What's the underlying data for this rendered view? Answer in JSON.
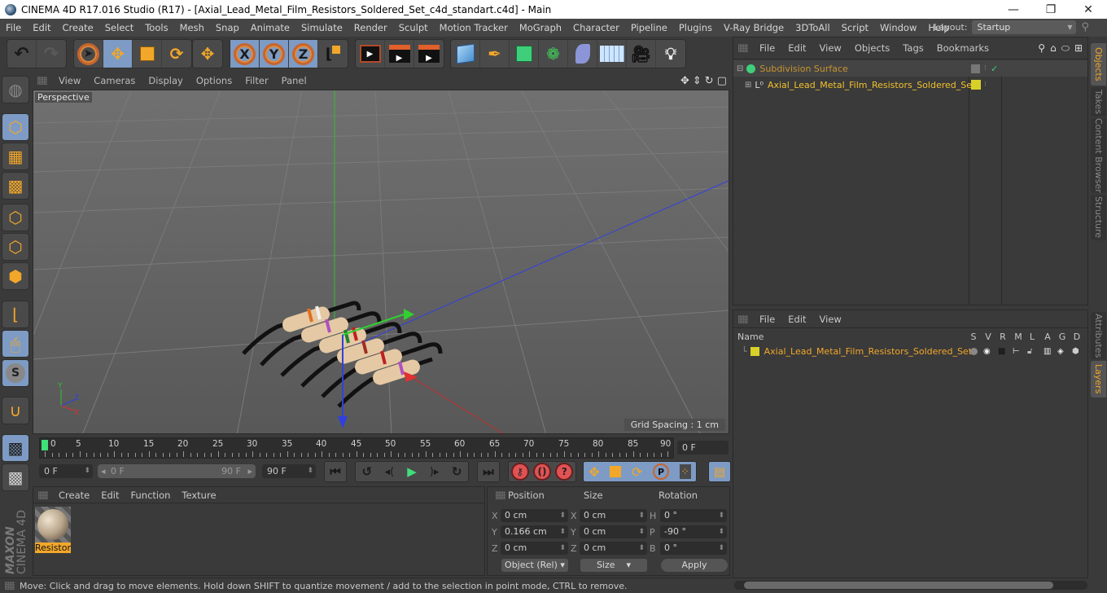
{
  "window": {
    "title": "CINEMA 4D R17.016 Studio (R17) - [Axial_Lead_Metal_Film_Resistors_Soldered_Set_c4d_standart.c4d] - Main",
    "minimize": "—",
    "maximize": "❐",
    "close": "✕"
  },
  "menubar": {
    "items": [
      "File",
      "Edit",
      "Create",
      "Select",
      "Tools",
      "Mesh",
      "Snap",
      "Animate",
      "Simulate",
      "Render",
      "Sculpt",
      "Motion Tracker",
      "MoGraph",
      "Character",
      "Pipeline",
      "Plugins",
      "V-Ray Bridge",
      "3DToAll",
      "Script",
      "Window",
      "Help"
    ],
    "layout_label": "Layout:",
    "layout_value": "Startup"
  },
  "toolbar": {
    "undo": "↶",
    "redo": "↷",
    "axis_x": "X",
    "axis_y": "Y",
    "axis_z": "Z"
  },
  "viewport": {
    "menu": [
      "View",
      "Cameras",
      "Display",
      "Options",
      "Filter",
      "Panel"
    ],
    "camera_label": "Perspective",
    "grid_spacing": "Grid Spacing : 1 cm",
    "axis_labels": {
      "x": "X",
      "y": "Y",
      "z": "Z"
    }
  },
  "timeline": {
    "ticks": [
      "0",
      "5",
      "10",
      "15",
      "20",
      "25",
      "30",
      "35",
      "40",
      "45",
      "50",
      "55",
      "60",
      "65",
      "70",
      "75",
      "80",
      "85",
      "90"
    ],
    "current_frame": "0 F",
    "start_field": "0 F",
    "range_start": "0 F",
    "range_end": "90 F",
    "end_field": "90 F"
  },
  "materials": {
    "menu": [
      "Create",
      "Edit",
      "Function",
      "Texture"
    ],
    "items": [
      {
        "name": "Resistor"
      }
    ]
  },
  "brand": {
    "line1": "MAXON",
    "line2": "CINEMA 4D"
  },
  "coordinates": {
    "headers": {
      "position": "Position",
      "size": "Size",
      "rotation": "Rotation"
    },
    "position": [
      {
        "axis": "X",
        "value": "0 cm"
      },
      {
        "axis": "Y",
        "value": "0.166 cm"
      },
      {
        "axis": "Z",
        "value": "0 cm"
      }
    ],
    "size": [
      {
        "axis": "X",
        "value": "0 cm"
      },
      {
        "axis": "Y",
        "value": "0 cm"
      },
      {
        "axis": "Z",
        "value": "0 cm"
      }
    ],
    "rotation": [
      {
        "axis": "H",
        "value": "0 °"
      },
      {
        "axis": "P",
        "value": "-90 °"
      },
      {
        "axis": "B",
        "value": "0 °"
      }
    ],
    "mode_dropdown": "Object (Rel)",
    "size_dropdown": "Size",
    "apply_label": "Apply"
  },
  "status": {
    "text": "Move: Click and drag to move elements. Hold down SHIFT to quantize movement / add to the selection in point mode, CTRL to remove."
  },
  "objects_panel": {
    "menu": [
      "File",
      "Edit",
      "View",
      "Objects",
      "Tags",
      "Bookmarks"
    ],
    "rows": [
      {
        "name": "Subdivision Surface",
        "color": "#c8932f"
      },
      {
        "name": "Axial_Lead_Metal_Film_Resistors_Soldered_Set",
        "color": "#f2c12e"
      }
    ]
  },
  "layers_panel": {
    "menu": [
      "File",
      "Edit",
      "View"
    ],
    "columns": [
      "Name",
      "S",
      "V",
      "R",
      "M",
      "L",
      "A",
      "G",
      "D"
    ],
    "rows": [
      {
        "name": "Axial_Lead_Metal_Film_Resistors_Soldered_Set",
        "color": "#d8d028"
      }
    ]
  },
  "side_tabs": {
    "top": [
      "Objects",
      "Takes",
      "Content Browser",
      "Structure"
    ],
    "bottom": [
      "Attributes",
      "Layers"
    ]
  },
  "colors": {
    "accent": "#f2a72a",
    "selected_blue": "#7d9bc4",
    "layer_yellow": "#d8d028",
    "axis_x": "#d83030",
    "axis_y": "#30c030",
    "axis_z": "#3040e0"
  }
}
